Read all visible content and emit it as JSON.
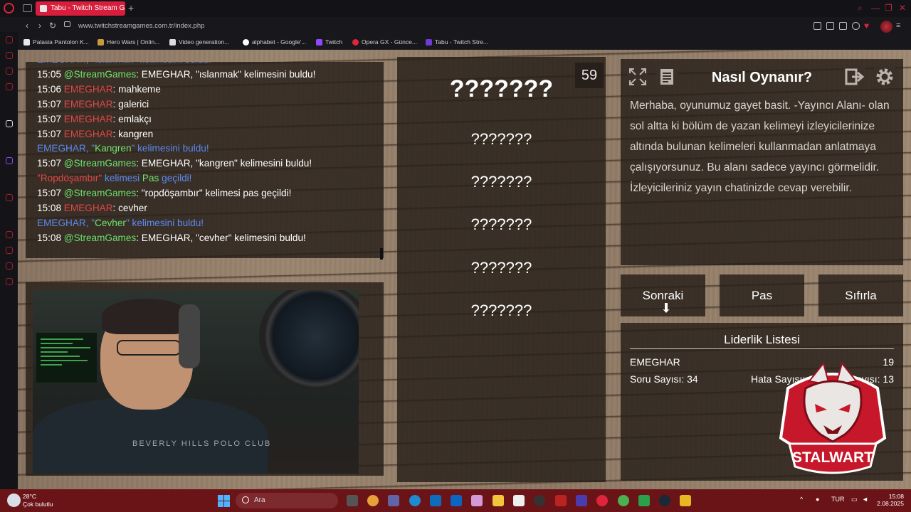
{
  "browser": {
    "tab_title": "Tabu - Twitch Stream Gam",
    "url": "www.twitchstreamgames.com.tr/index.php",
    "bookmarks": [
      "Palasia Pantolon K...",
      "Hero Wars | Onlin...",
      "Video generation...",
      "alphabet - Google'...",
      "Twitch",
      "Opera GX - Günce...",
      "Tabu - Twitch Stre..."
    ]
  },
  "chat": {
    "lines": [
      [
        {
          "t": "EMEGHAR, \"ıslanmak\" kelimesini buldu!",
          "c": "c-blue"
        }
      ],
      [
        {
          "t": "15:05 ",
          "c": "c-white"
        },
        {
          "t": "@StreamGames",
          "c": "c-green"
        },
        {
          "t": ": EMEGHAR, \"ıslanmak\" kelimesini buldu!",
          "c": "c-white"
        }
      ],
      [
        {
          "t": "15:06 ",
          "c": "c-white"
        },
        {
          "t": "EMEGHAR",
          "c": "c-red"
        },
        {
          "t": ": mahkeme",
          "c": "c-white"
        }
      ],
      [
        {
          "t": "15:07 ",
          "c": "c-white"
        },
        {
          "t": "EMEGHAR",
          "c": "c-red"
        },
        {
          "t": ": galerici",
          "c": "c-white"
        }
      ],
      [
        {
          "t": "15:07 ",
          "c": "c-white"
        },
        {
          "t": "EMEGHAR",
          "c": "c-red"
        },
        {
          "t": ": emlakçı",
          "c": "c-white"
        }
      ],
      [
        {
          "t": "15:07 ",
          "c": "c-white"
        },
        {
          "t": "EMEGHAR",
          "c": "c-red"
        },
        {
          "t": ": kangren",
          "c": "c-white"
        }
      ],
      [
        {
          "t": "EMEGHAR, \"",
          "c": "c-blue"
        },
        {
          "t": "Kangren",
          "c": "c-green"
        },
        {
          "t": "\" kelimesini buldu!",
          "c": "c-blue"
        }
      ],
      [
        {
          "t": "15:07 ",
          "c": "c-white"
        },
        {
          "t": "@StreamGames",
          "c": "c-green"
        },
        {
          "t": ": EMEGHAR, \"kangren\" kelimesini buldu!",
          "c": "c-white"
        }
      ],
      [
        {
          "t": "\"Ropdöşambır\"",
          "c": "c-red"
        },
        {
          "t": " kelimesi ",
          "c": "c-blue"
        },
        {
          "t": "Pas",
          "c": "c-green"
        },
        {
          "t": " geçildi!",
          "c": "c-blue"
        }
      ],
      [
        {
          "t": "15:07 ",
          "c": "c-white"
        },
        {
          "t": "@StreamGames",
          "c": "c-green"
        },
        {
          "t": ": \"ropdöşambır\" kelimesi pas geçildi!",
          "c": "c-white"
        }
      ],
      [
        {
          "t": "15:08 ",
          "c": "c-white"
        },
        {
          "t": "EMEGHAR",
          "c": "c-red"
        },
        {
          "t": ": cevher",
          "c": "c-white"
        }
      ],
      [
        {
          "t": "EMEGHAR, \"",
          "c": "c-blue"
        },
        {
          "t": "Cevher",
          "c": "c-green"
        },
        {
          "t": "\" kelimesini buldu!",
          "c": "c-blue"
        }
      ],
      [
        {
          "t": "15:08 ",
          "c": "c-white"
        },
        {
          "t": "@StreamGames",
          "c": "c-green"
        },
        {
          "t": ": EMEGHAR, \"cevher\" kelimesini buldu!",
          "c": "c-white"
        }
      ]
    ]
  },
  "webcam": {
    "shirt_text": "BEVERLY HILLS POLO CLUB"
  },
  "game": {
    "timer": "59",
    "main_word": "???????",
    "taboo_words": [
      "???????",
      "???????",
      "???????",
      "???????",
      "???????"
    ]
  },
  "howto": {
    "title": "Nasıl Oynanır?",
    "text": "Merhaba, oyunumuz gayet basit. -Yayıncı Alanı- olan sol altta ki bölüm de yazan kelimeyi izleyicilerinize altında bulunan kelimeleri kullanmadan anlatmaya çalışıyorsunuz. Bu alanı sadece yayıncı görmelidir. İzleyicileriniz yayın chatinizde cevap verebilir."
  },
  "buttons": {
    "next": "Sonraki",
    "pass": "Pas",
    "reset": "Sıfırla"
  },
  "leaderboard": {
    "title": "Liderlik Listesi",
    "player": "EMEGHAR",
    "score": "19",
    "questions": "Soru Sayısı: 34",
    "errors": "Hata Sayısı: 14",
    "pass_count": "Pas Sayısı: 13",
    "logo_text": "STALWART"
  },
  "taskbar": {
    "temperature": "28°C",
    "condition": "Çok bulutlu",
    "search_label": "Ara",
    "language": "TUR",
    "time": "15:08",
    "date": "2.08.2025"
  },
  "colors": {
    "accent": "#d81e3c",
    "taskbar": "#6b1418",
    "chat_user": "#e04848",
    "chat_bot": "#6ee36e",
    "chat_system": "#5b8af0"
  }
}
